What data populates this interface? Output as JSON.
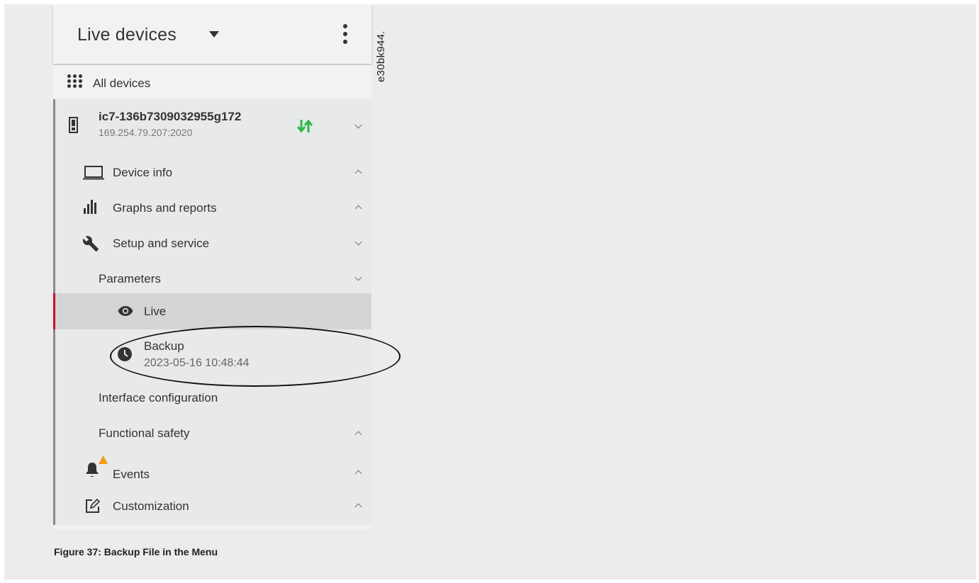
{
  "header": {
    "title": "Live devices"
  },
  "all_devices": {
    "label": "All devices"
  },
  "device": {
    "name": "ic7-136b7309032955g172",
    "address": "169.254.79.207:2020",
    "status_color": "#2db84b"
  },
  "menu": {
    "device_info": "Device info",
    "graphs_reports": "Graphs and reports",
    "setup_service": "Setup and service",
    "parameters": "Parameters",
    "live": "Live",
    "backup": {
      "title": "Backup",
      "date": "2023-05-16 10:48:44"
    },
    "interface_config": "Interface configuration",
    "functional_safety": "Functional safety",
    "events": "Events",
    "customization": "Customization"
  },
  "colors": {
    "selected_accent": "#c8102e",
    "selected_bg": "#d3d5d7",
    "warning": "#f39c12"
  },
  "document_id": "e30bk944.",
  "caption": "Figure 37:  Backup File in the Menu"
}
